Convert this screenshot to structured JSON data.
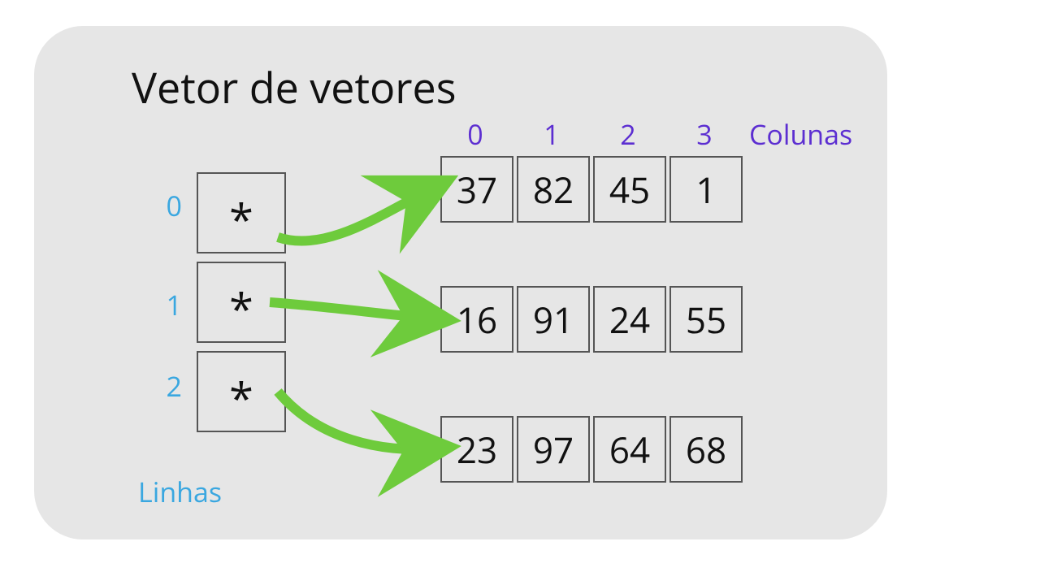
{
  "title": "Vetor de vetores",
  "labels": {
    "columns": "Colunas",
    "rows": "Linhas"
  },
  "column_indices": [
    "0",
    "1",
    "2",
    "3"
  ],
  "row_indices": [
    "0",
    "1",
    "2"
  ],
  "pointer_symbol": "*",
  "matrix": {
    "rows": [
      [
        "37",
        "82",
        "45",
        "1"
      ],
      [
        "16",
        "91",
        "24",
        "55"
      ],
      [
        "23",
        "97",
        "64",
        "68"
      ]
    ]
  },
  "colors": {
    "column_index": "#5c2ed1",
    "row_index": "#3aa7e0",
    "arrow": "#6ecb3c",
    "panel_bg": "#e6e6e6",
    "cell_border": "#555555",
    "text": "#111111"
  }
}
